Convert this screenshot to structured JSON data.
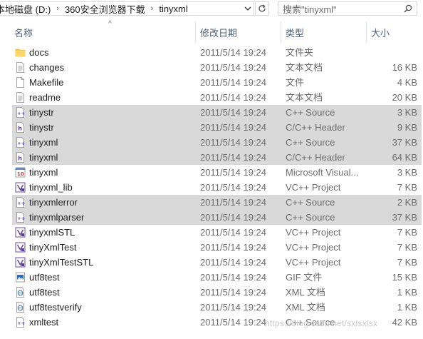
{
  "breadcrumb": [
    "本地磁盘 (D:)",
    "360安全浏览器下载",
    "tinyxml"
  ],
  "search": {
    "placeholder": "搜索\"tinyxml\""
  },
  "columns": {
    "name": "名称",
    "date": "修改日期",
    "type": "类型",
    "size": "大小"
  },
  "files": [
    {
      "name": "docs",
      "date": "2011/5/14 19:24",
      "type": "文件夹",
      "size": "",
      "icon": "folder-icon",
      "selected": false
    },
    {
      "name": "changes",
      "date": "2011/5/14 19:24",
      "type": "文本文档",
      "size": "16 KB",
      "icon": "text-file-icon",
      "selected": false
    },
    {
      "name": "Makefile",
      "date": "2011/5/14 19:24",
      "type": "文件",
      "size": "4 KB",
      "icon": "blank-file-icon",
      "selected": false
    },
    {
      "name": "readme",
      "date": "2011/5/14 19:24",
      "type": "文本文档",
      "size": "20 KB",
      "icon": "text-file-icon",
      "selected": false
    },
    {
      "name": "tinystr",
      "date": "2011/5/14 19:24",
      "type": "C++ Source",
      "size": "3 KB",
      "icon": "cpp-source-icon",
      "selected": true
    },
    {
      "name": "tinystr",
      "date": "2011/5/14 19:24",
      "type": "C/C++ Header",
      "size": "9 KB",
      "icon": "cpp-header-icon",
      "selected": true
    },
    {
      "name": "tinyxml",
      "date": "2011/5/14 19:24",
      "type": "C++ Source",
      "size": "37 KB",
      "icon": "cpp-source-icon",
      "selected": true
    },
    {
      "name": "tinyxml",
      "date": "2011/5/14 19:24",
      "type": "C/C++ Header",
      "size": "64 KB",
      "icon": "cpp-header-icon",
      "selected": true
    },
    {
      "name": "tinyxml",
      "date": "2011/5/14 19:24",
      "type": "Microsoft Visual...",
      "size": "3 KB",
      "icon": "vs-solution-icon",
      "selected": false
    },
    {
      "name": "tinyxml_lib",
      "date": "2011/5/14 19:24",
      "type": "VC++ Project",
      "size": "7 KB",
      "icon": "vc-project-icon",
      "selected": false
    },
    {
      "name": "tinyxmlerror",
      "date": "2011/5/14 19:24",
      "type": "C++ Source",
      "size": "2 KB",
      "icon": "cpp-source-icon",
      "selected": true
    },
    {
      "name": "tinyxmlparser",
      "date": "2011/5/14 19:24",
      "type": "C++ Source",
      "size": "37 KB",
      "icon": "cpp-source-icon",
      "selected": true
    },
    {
      "name": "tinyxmlSTL",
      "date": "2011/5/14 19:24",
      "type": "VC++ Project",
      "size": "7 KB",
      "icon": "vc-project-icon",
      "selected": false
    },
    {
      "name": "tinyXmlTest",
      "date": "2011/5/14 19:24",
      "type": "VC++ Project",
      "size": "7 KB",
      "icon": "vc-project-icon",
      "selected": false
    },
    {
      "name": "tinyXmlTestSTL",
      "date": "2011/5/14 19:24",
      "type": "VC++ Project",
      "size": "7 KB",
      "icon": "vc-project-icon",
      "selected": false
    },
    {
      "name": "utf8test",
      "date": "2011/5/14 19:24",
      "type": "GIF 文件",
      "size": "15 KB",
      "icon": "gif-image-icon",
      "selected": false
    },
    {
      "name": "utf8test",
      "date": "2011/5/14 19:24",
      "type": "XML 文档",
      "size": "1 KB",
      "icon": "xml-file-icon",
      "selected": false
    },
    {
      "name": "utf8testverify",
      "date": "2011/5/14 19:24",
      "type": "XML 文档",
      "size": "1 KB",
      "icon": "xml-file-icon",
      "selected": false
    },
    {
      "name": "xmltest",
      "date": "2011/5/14 19:24",
      "type": "C++ Source",
      "size": "42 KB",
      "icon": "cpp-source-icon",
      "selected": false
    }
  ],
  "watermark": "https://blog.csdn.net/sxlsxlsx",
  "colors": {
    "selection": "#d9d9d9",
    "header_text": "#4c607a",
    "meta_text": "#6d6d6d",
    "folder": "#f6c644"
  }
}
